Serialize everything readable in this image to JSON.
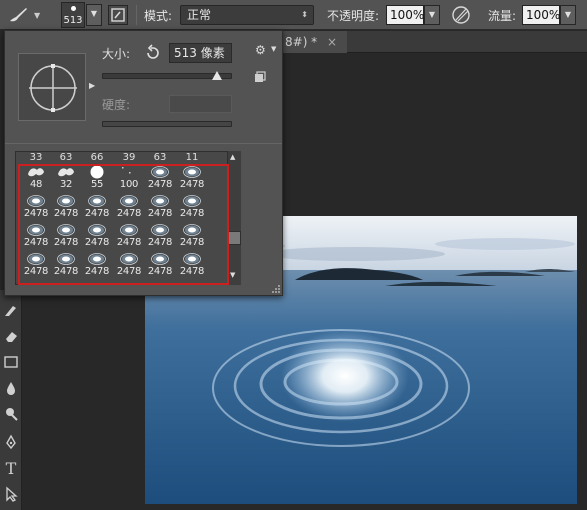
{
  "options_bar": {
    "brush_size": "513",
    "mode_label": "模式:",
    "mode_value": "正常",
    "opacity_label": "不透明度:",
    "opacity_value": "100%",
    "flow_label": "流量:",
    "flow_value": "100%"
  },
  "document_tab": {
    "title": "8#) *",
    "close": "×"
  },
  "brush_panel": {
    "size_label": "大小:",
    "size_value": "513 像素",
    "hardness_label": "硬度:",
    "top_row_sizes": [
      "33",
      "63",
      "66",
      "39",
      "63",
      "11"
    ],
    "rows": [
      [
        "48",
        "32",
        "55",
        "100",
        "2478",
        "2478"
      ],
      [
        "2478",
        "2478",
        "2478",
        "2478",
        "2478",
        "2478"
      ],
      [
        "2478",
        "2478",
        "2478",
        "2478",
        "2478",
        "2478"
      ],
      [
        "2478",
        "2478",
        "2478",
        "2478",
        "2478",
        "2478"
      ]
    ],
    "scroll_up": "▲",
    "scroll_down": "▼"
  },
  "tools": [
    "brush-tool",
    "eraser-tool",
    "gradient-tool",
    "blur-tool",
    "dodge-tool",
    "pen-tool",
    "type-tool",
    "path-select-tool"
  ],
  "type_tool_glyph": "T",
  "colors": {
    "highlight_box": "#cc1f1f",
    "panel_bg": "#535353",
    "workspace_bg": "#282828"
  }
}
